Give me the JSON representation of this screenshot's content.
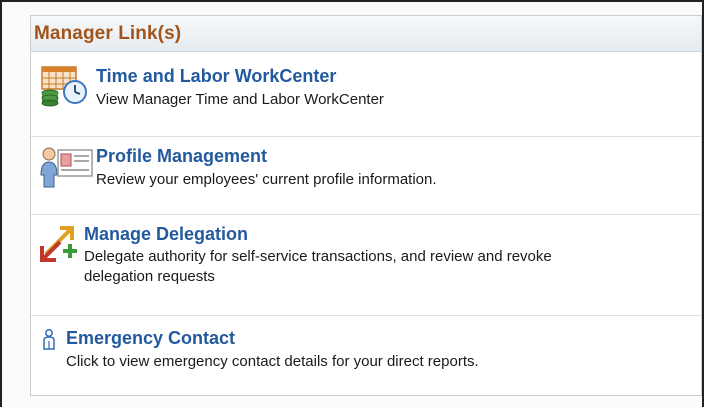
{
  "pagelet": {
    "title": "Manager Link(s)"
  },
  "links": [
    {
      "title": "Time and Labor WorkCenter",
      "description": "View Manager Time and Labor WorkCenter",
      "icon": "calendar-clock-database-icon"
    },
    {
      "title": "Profile Management",
      "description": "Review your employees' current profile information.",
      "icon": "person-profile-card-icon"
    },
    {
      "title": "Manage Delegation",
      "description_line1": "Delegate authority for self-service transactions, and review and revoke",
      "description_line2": "delegation requests",
      "icon": "delegation-arrows-icon"
    },
    {
      "title": "Emergency Contact",
      "description": "Click to view emergency contact details for your direct reports.",
      "icon": "person-icon"
    }
  ],
  "colors": {
    "header_text": "#a2541b",
    "link_text": "#235a9e",
    "border": "#c9ced6"
  }
}
